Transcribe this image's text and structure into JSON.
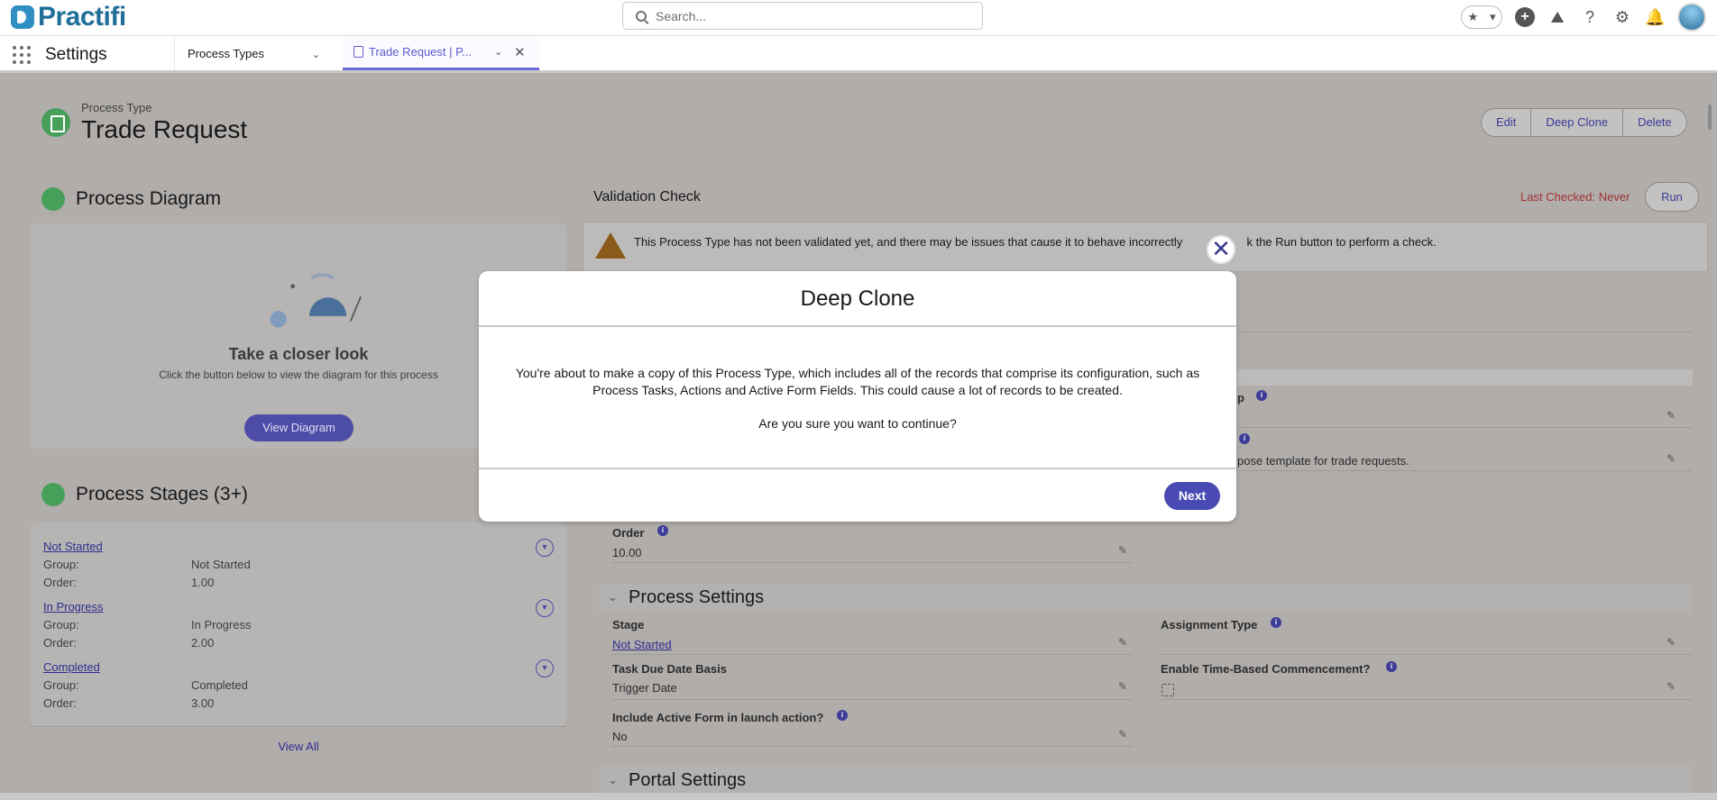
{
  "brand": {
    "name": "Practifi"
  },
  "search": {
    "placeholder": "Search..."
  },
  "nav": {
    "app_name": "Settings",
    "tabs": [
      {
        "label": "Process Types"
      },
      {
        "label": "Trade Request | P..."
      }
    ]
  },
  "record": {
    "type_label": "Process Type",
    "title": "Trade Request",
    "actions": [
      "Edit",
      "Deep Clone",
      "Delete"
    ]
  },
  "diagram": {
    "title": "Process Diagram",
    "heading": "Take a closer look",
    "subtitle": "Click the button below to view the diagram for this process",
    "button": "View Diagram"
  },
  "stages": {
    "title": "Process Stages (3+)",
    "group_label": "Group:",
    "order_label": "Order:",
    "items": [
      {
        "name": "Not Started",
        "group": "Not Started",
        "order": "1.00"
      },
      {
        "name": "In Progress",
        "group": "In Progress",
        "order": "2.00"
      },
      {
        "name": "Completed",
        "group": "Completed",
        "order": "3.00"
      }
    ],
    "view_all": "View All"
  },
  "validation": {
    "title": "Validation Check",
    "last_checked": "Last Checked: Never",
    "run": "Run",
    "warning_left": "This Process Type has not been validated yet, and there may be issues that cause it to behave incorrectly",
    "warning_right": "k the Run button to perform a check."
  },
  "details": {
    "partial_label_1": "p",
    "partial_value_2": "pose template for trade requests.",
    "order_label": "Order",
    "order_value": "10.00",
    "process_settings": "Process Settings",
    "stage_label": "Stage",
    "stage_value": "Not Started",
    "assignment_label": "Assignment Type",
    "due_basis_label": "Task Due Date Basis",
    "due_basis_value": "Trigger Date",
    "commencement_label": "Enable Time-Based Commencement?",
    "active_form_label": "Include Active Form in launch action?",
    "active_form_value": "No",
    "portal_settings": "Portal Settings"
  },
  "modal": {
    "title": "Deep Clone",
    "message": "You're about to make a copy of this Process Type, which includes all of the records that comprise its configuration, such as Process Tasks, Actions and Active Form Fields. This could cause a lot of records to be created.",
    "question": "Are you sure you want to continue?",
    "next": "Next"
  },
  "icons": [
    "search-icon",
    "star-icon",
    "add-icon",
    "trailhead-icon",
    "help-icon",
    "gear-icon",
    "bell-icon",
    "close-icon",
    "warning-icon",
    "pencil-icon",
    "info-icon",
    "chevron-down-icon"
  ]
}
